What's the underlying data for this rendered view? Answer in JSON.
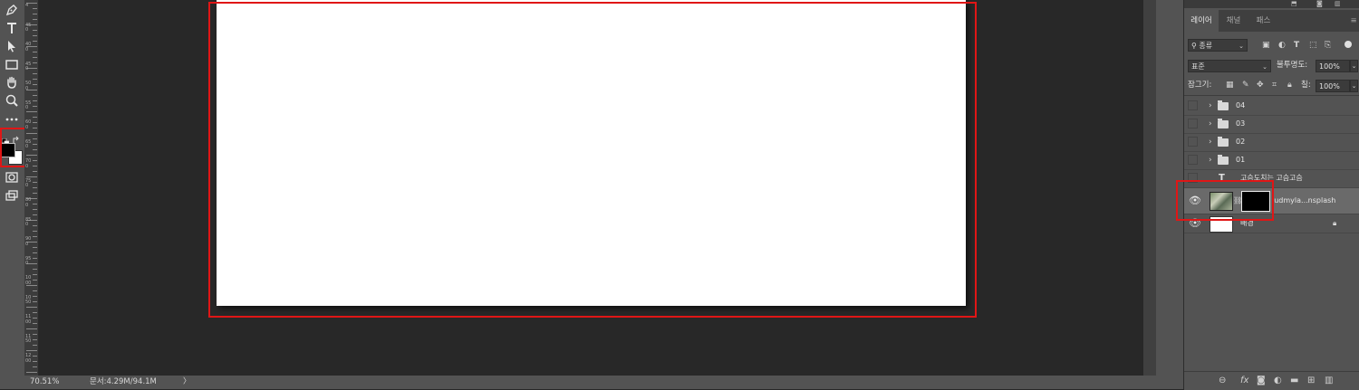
{
  "status": {
    "zoom": "70.51%",
    "doc_info": "문서:4.29M/94.1M",
    "arrow": "〉"
  },
  "ruler_numbers": [
    "4",
    "4 5 0",
    "4 0 0",
    "4 5 0",
    "5 0 0",
    "5 5 0",
    "6 0 0",
    "6 5 0",
    "7 0 0",
    "7 5 0",
    "8 0 0",
    "8 5 0",
    "9 0 0",
    "9 5 0",
    "1 0 0 0",
    "1 0 5 0",
    "1 1 0 0",
    "1 1 5 0",
    "1 2 0 0"
  ],
  "panel": {
    "tabs": [
      "레이어",
      "채널",
      "패스"
    ],
    "menu_icon": "≡",
    "filter": {
      "label": "종류",
      "icons": [
        "image-icon",
        "adjustment-icon",
        "type-icon",
        "shape-icon",
        "smart-object-icon"
      ]
    },
    "blend_mode": "표준",
    "opacity_label": "불투명도:",
    "opacity_value": "100%",
    "lock_label": "잠그기:",
    "fill_label": "칠:",
    "fill_value": "100%",
    "layers": [
      {
        "name": "04",
        "kind": "group",
        "visible": false,
        "selected": false
      },
      {
        "name": "03",
        "kind": "group",
        "visible": false,
        "selected": false
      },
      {
        "name": "02",
        "kind": "group",
        "visible": false,
        "selected": false
      },
      {
        "name": "01",
        "kind": "group",
        "visible": false,
        "selected": false
      },
      {
        "name": "고슴도치는 고슴고슴",
        "kind": "text",
        "visible": false,
        "selected": false
      },
      {
        "name": "ludmyla...nsplash",
        "kind": "smart-masked",
        "visible": true,
        "selected": true
      },
      {
        "name": "배경",
        "kind": "background",
        "visible": true,
        "selected": false,
        "locked": true
      }
    ],
    "bottom_icons": [
      "link-icon",
      "fx-icon",
      "mask-icon",
      "adjustment-icon",
      "folder-icon",
      "new-layer-icon",
      "trash-icon"
    ],
    "fx_label": "fx"
  },
  "colors": {
    "highlight": "#e01616",
    "foreground": "#000000",
    "background": "#ffffff"
  }
}
